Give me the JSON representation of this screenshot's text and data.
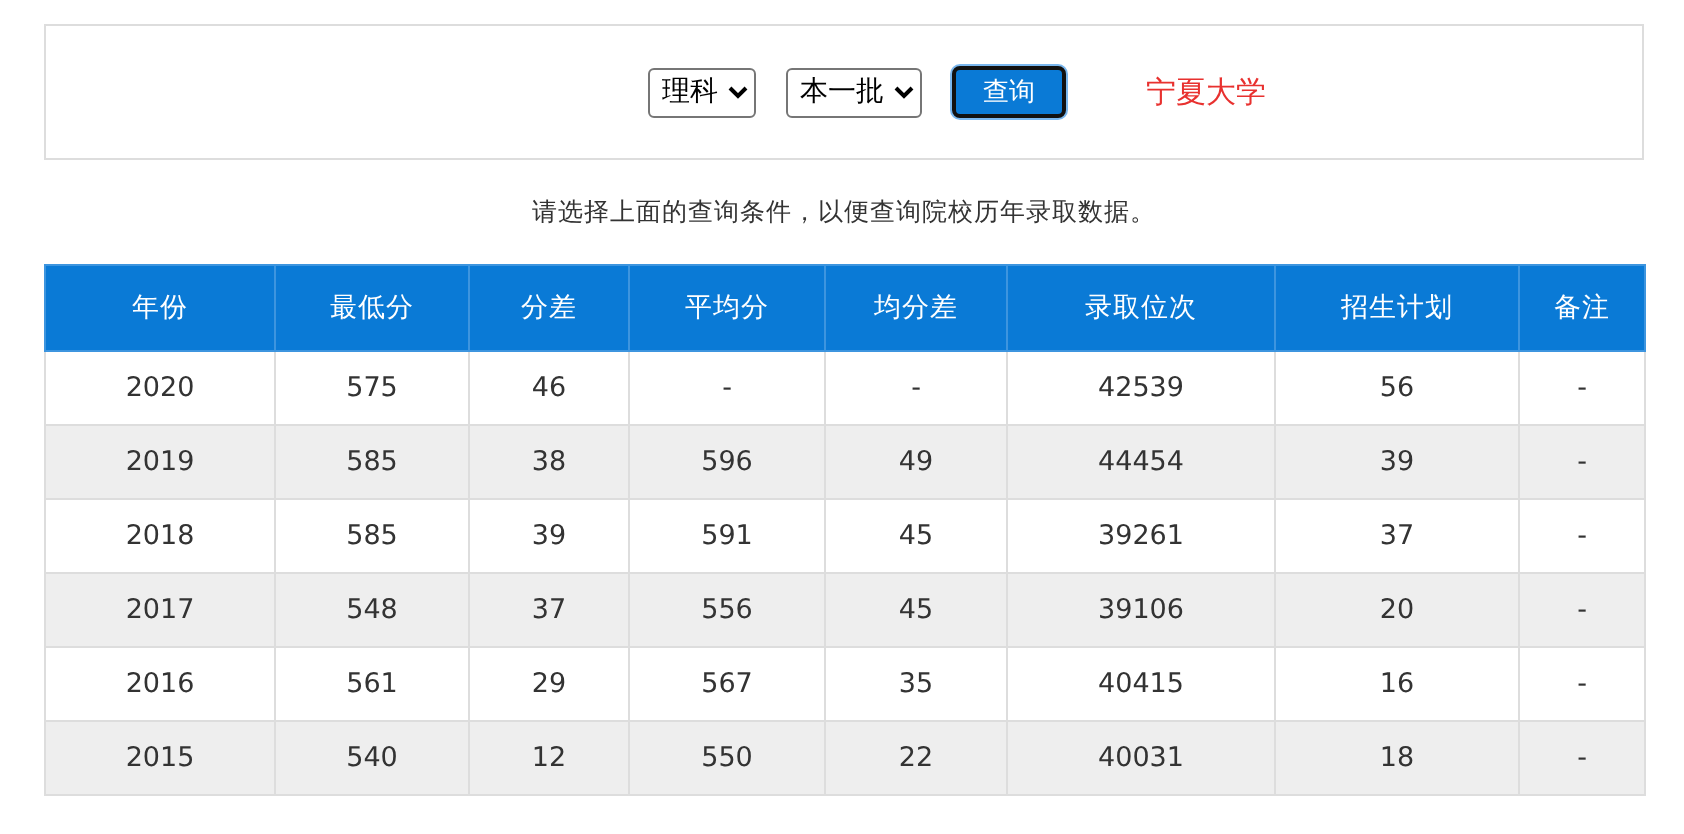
{
  "filters": [
    {
      "value": "理科"
    },
    {
      "value": "本一批"
    }
  ],
  "query_button": "查询",
  "university": "宁夏大学",
  "hint": "请选择上面的查询条件，以便查询院校历年录取数据。",
  "table": {
    "columns": [
      "年份",
      "最低分",
      "分差",
      "平均分",
      "均分差",
      "录取位次",
      "招生计划",
      "备注"
    ],
    "rows": [
      [
        "2020",
        "575",
        "46",
        "-",
        "-",
        "42539",
        "56",
        "-"
      ],
      [
        "2019",
        "585",
        "38",
        "596",
        "49",
        "44454",
        "39",
        "-"
      ],
      [
        "2018",
        "585",
        "39",
        "591",
        "45",
        "39261",
        "37",
        "-"
      ],
      [
        "2017",
        "548",
        "37",
        "556",
        "45",
        "39106",
        "20",
        "-"
      ],
      [
        "2016",
        "561",
        "29",
        "567",
        "35",
        "40415",
        "16",
        "-"
      ],
      [
        "2015",
        "540",
        "12",
        "550",
        "22",
        "40031",
        "18",
        "-"
      ]
    ]
  }
}
